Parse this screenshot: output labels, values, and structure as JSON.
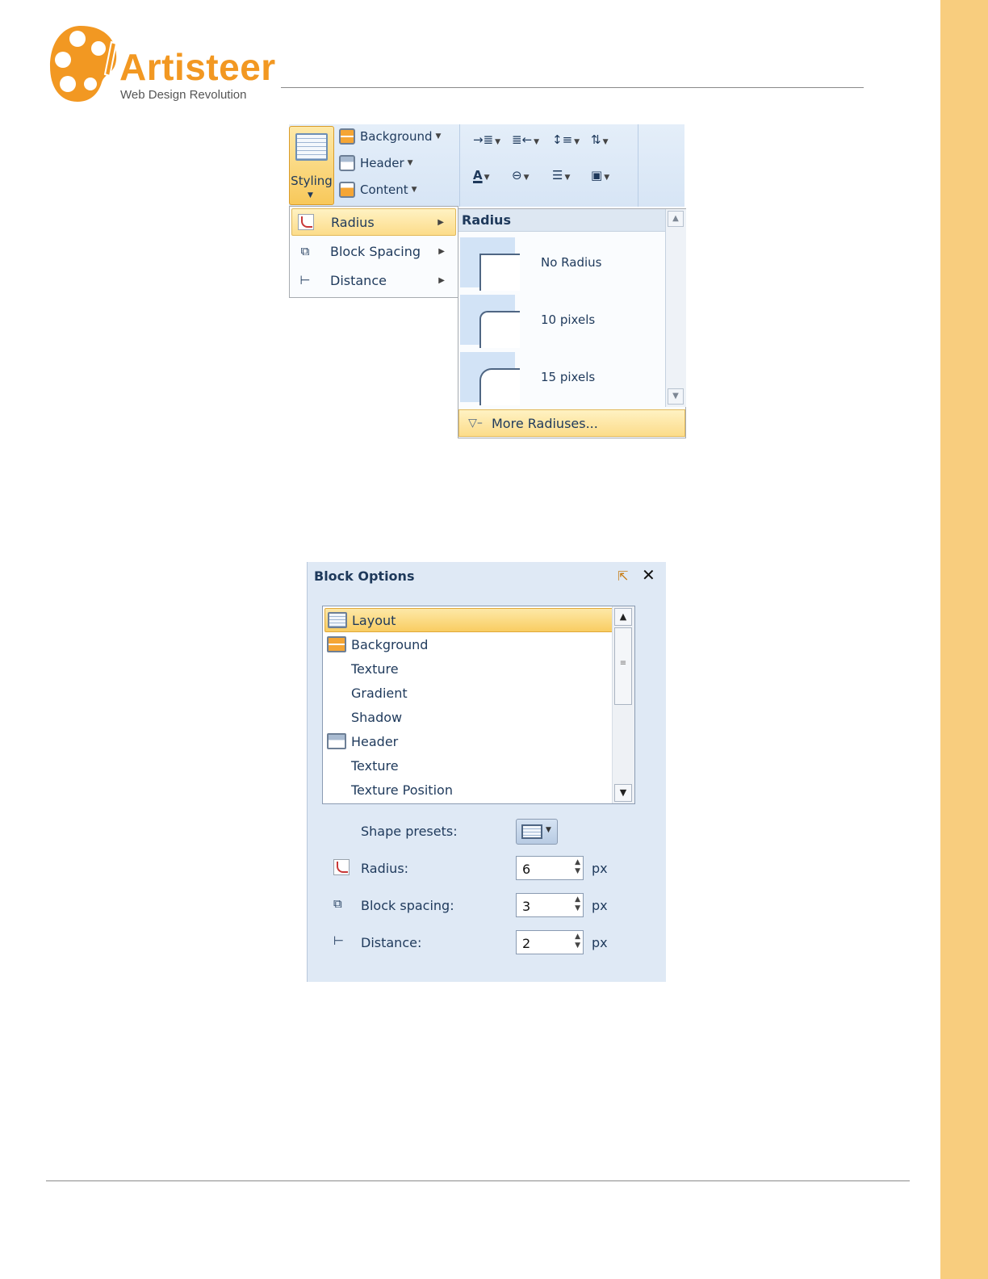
{
  "logo": {
    "name": "Artisteer",
    "tagline": "Web Design Revolution"
  },
  "ribbon": {
    "styling_label": "Styling",
    "items": [
      "Background",
      "Header",
      "Content"
    ]
  },
  "menu": {
    "items": [
      {
        "label": "Radius",
        "icon": "radius-icon"
      },
      {
        "label": "Block Spacing",
        "icon": "block-spacing-icon"
      },
      {
        "label": "Distance",
        "icon": "distance-icon"
      }
    ]
  },
  "gallery": {
    "title": "Radius",
    "items": [
      "No Radius",
      "10 pixels",
      "15 pixels"
    ],
    "more_label": "More Radiuses..."
  },
  "panel": {
    "title": "Block Options",
    "list": [
      "Layout",
      "Background",
      "Texture",
      "Gradient",
      "Shadow",
      "Header",
      "Texture",
      "Texture Position"
    ],
    "shape_presets_label": "Shape presets:",
    "radius": {
      "label": "Radius:",
      "value": "6",
      "unit": "px"
    },
    "block_spacing": {
      "label": "Block spacing:",
      "value": "3",
      "unit": "px"
    },
    "distance": {
      "label": "Distance:",
      "value": "2",
      "unit": "px"
    }
  },
  "colors": {
    "brand_orange": "#f29822",
    "side_band": "#f8cd7e",
    "selection": "#f9cd62"
  }
}
